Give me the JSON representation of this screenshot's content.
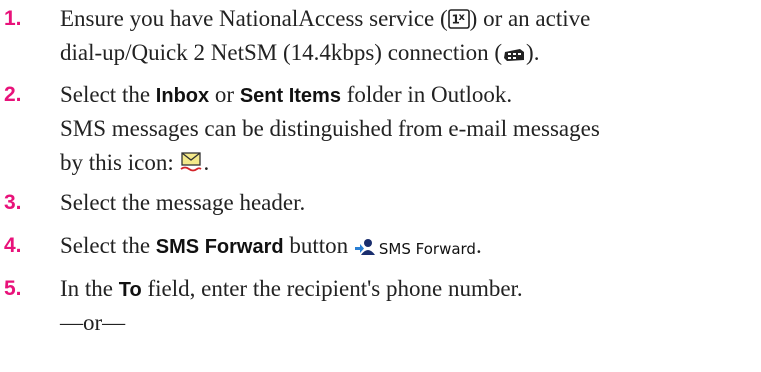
{
  "steps": [
    {
      "number": "1.",
      "line1_a": "Ensure you have NationalAccess service (",
      "line1_b": ") or an active",
      "line2_a": "dial-up/Quick 2 NetSM (14.4kbps) connection (",
      "line2_b": ")."
    },
    {
      "number": "2.",
      "a": "Select the ",
      "inbox": "Inbox",
      "b": " or ",
      "sent": "Sent Items",
      "c": " folder in Outlook.",
      "line2": "SMS messages can be distinguished from e-mail messages",
      "line3_a": "by this icon: ",
      "line3_b": "."
    },
    {
      "number": "3.",
      "text": "Select the message header."
    },
    {
      "number": "4.",
      "a": "Select the ",
      "button_name": "SMS Forward",
      "b": " button ",
      "button_label": "SMS Forward",
      "c": "."
    },
    {
      "number": "5.",
      "a": "In the ",
      "field": "To",
      "b": " field, enter the recipient's phone number.",
      "or": "—or—"
    }
  ],
  "icons": {
    "national_access": "1x-service-icon",
    "dialup": "dialup-connection-icon",
    "sms_message": "sms-envelope-icon",
    "sms_forward": "sms-forward-icon"
  },
  "colors": {
    "step_number": "#e8127a",
    "text": "#222222"
  }
}
